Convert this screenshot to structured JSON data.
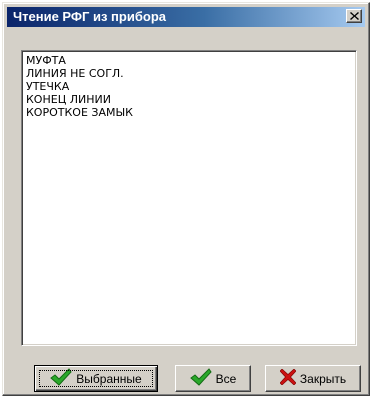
{
  "window": {
    "title": "Чтение РФГ из прибора"
  },
  "list": {
    "items": [
      "МУФТА",
      "ЛИНИЯ НЕ СОГЛ.",
      "УТЕЧКА",
      "КОНЕЦ ЛИНИИ",
      "КОРОТКОЕ ЗАМЫК"
    ]
  },
  "buttons": {
    "selected_label": "Выбранные",
    "all_label": "Все",
    "close_label": "Закрыть"
  },
  "icons": {
    "close": "close-icon",
    "check": "check-icon",
    "cross": "cross-icon"
  },
  "colors": {
    "title_start": "#0a246a",
    "title_end": "#a6caf0",
    "face": "#d4d0c8",
    "check_green": "#2aa82a",
    "cross_red": "#cc1111"
  }
}
